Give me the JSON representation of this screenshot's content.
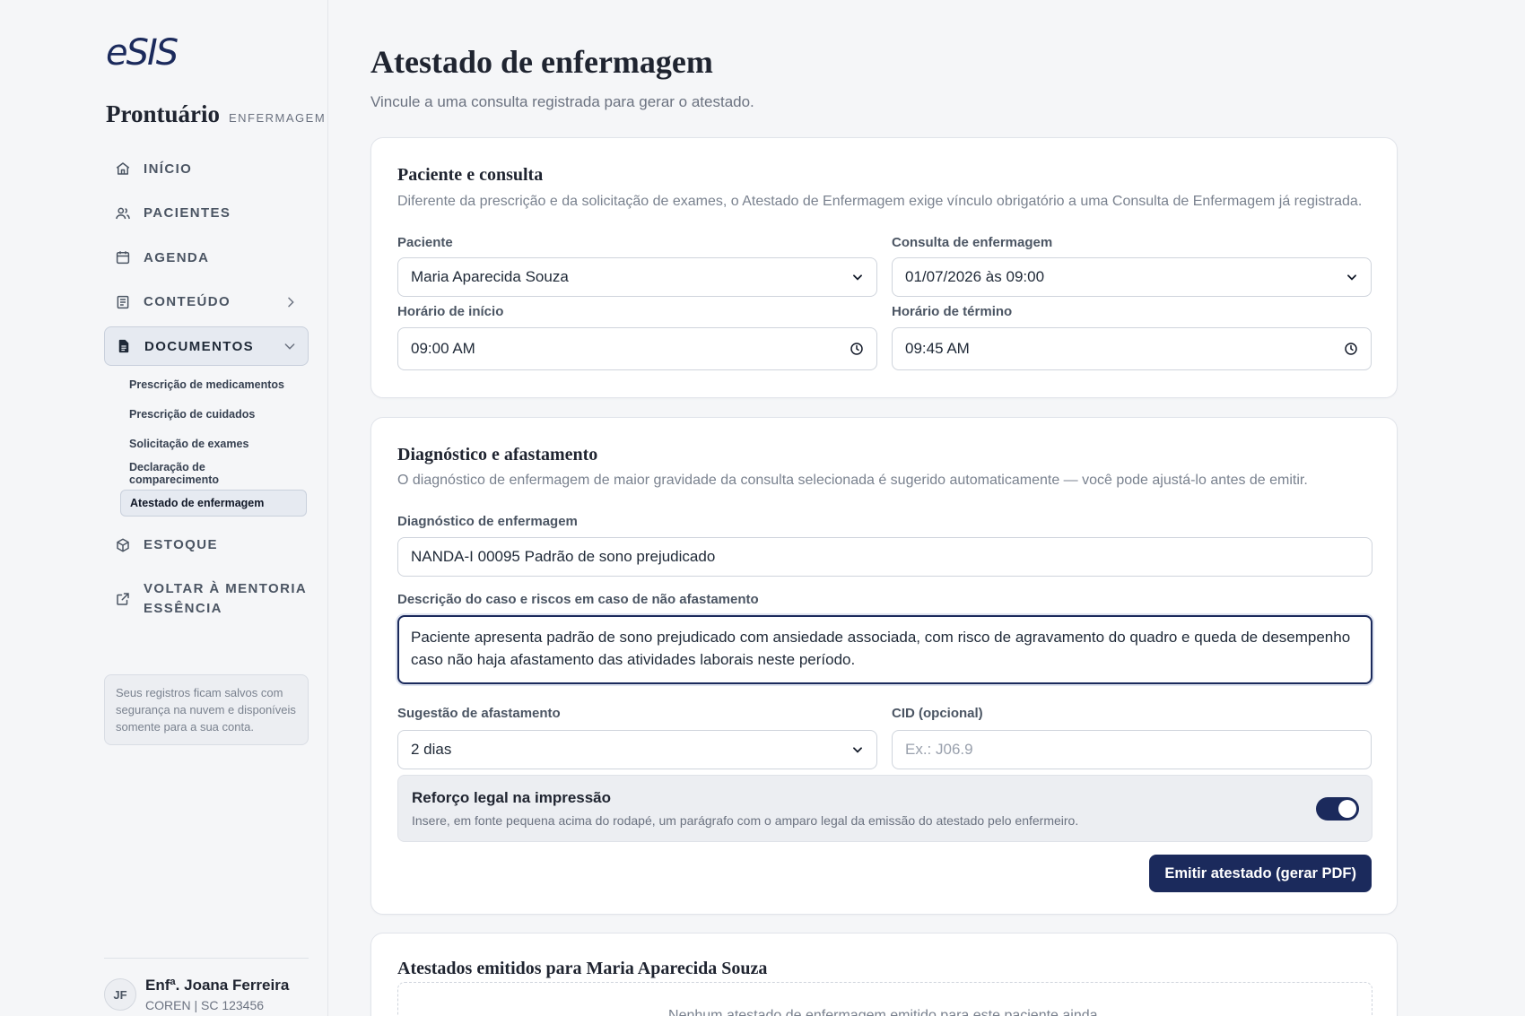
{
  "app": {
    "logo": "eSIS",
    "title": "Prontuário",
    "subtitle": "ENFERMAGEM"
  },
  "nav": {
    "inicio": "INÍCIO",
    "pacientes": "PACIENTES",
    "agenda": "AGENDA",
    "conteudo": "CONTEÚDO",
    "documentos": "DOCUMENTOS",
    "estoque": "ESTOQUE",
    "voltar_line1": "VOLTAR À MENTORIA",
    "voltar_line2": "ESSÊNCIA",
    "documentos_sub": [
      "Prescrição de medicamentos",
      "Prescrição de cuidados",
      "Solicitação de exames",
      "Declaração de comparecimento",
      "Atestado de enfermagem"
    ]
  },
  "sidebar_note": "Seus registros ficam salvos com segurança na nuvem e disponíveis somente para a sua conta.",
  "user": {
    "initials": "JF",
    "name": "Enfª. Joana Ferreira",
    "meta": "COREN | SC 123456"
  },
  "page": {
    "title": "Atestado de enfermagem",
    "subtitle": "Vincule a uma consulta registrada para gerar o atestado."
  },
  "patient_card": {
    "title": "Paciente e consulta",
    "description": "Diferente da prescrição e da solicitação de exames, o Atestado de Enfermagem exige vínculo obrigatório a uma Consulta de Enfermagem já registrada.",
    "patient_label": "Paciente",
    "patient_value": "Maria Aparecida Souza",
    "consult_label": "Consulta de enfermagem",
    "consult_value": "01/07/2026 às 09:00",
    "start_label": "Horário de início",
    "start_value": "09:00  AM",
    "end_label": "Horário de término",
    "end_value": "09:45  AM"
  },
  "diagnosis_card": {
    "title": "Diagnóstico e afastamento",
    "description": "O diagnóstico de enfermagem de maior gravidade da consulta selecionada é sugerido automaticamente — você pode ajustá-lo antes de emitir.",
    "diag_label": "Diagnóstico de enfermagem",
    "diag_value": "NANDA-I 00095 Padrão de sono prejudicado",
    "case_label": "Descrição do caso e riscos em caso de não afastamento",
    "case_value": "Paciente apresenta padrão de sono prejudicado com ansiedade associada, com risco de agravamento do quadro e queda de desempenho caso não haja afastamento das atividades laborais neste período.",
    "leave_label": "Sugestão de afastamento",
    "leave_value": "2 dias",
    "cid_label": "CID (opcional)",
    "cid_placeholder": "Ex.: J06.9",
    "toggle_title": "Reforço legal na impressão",
    "toggle_desc": "Insere, em fonte pequena acima do rodapé, um parágrafo com o amparo legal da emissão do atestado pelo enfermeiro.",
    "toggle_on": true,
    "submit_label": "Emitir atestado (gerar PDF)"
  },
  "history_card": {
    "title": "Atestados emitidos para Maria Aparecida Souza",
    "empty": "Nenhum atestado de enfermagem emitido para este paciente ainda."
  },
  "colors": {
    "primary": "#1b2a5c",
    "background": "#f5f6f8",
    "card": "#ffffff"
  }
}
